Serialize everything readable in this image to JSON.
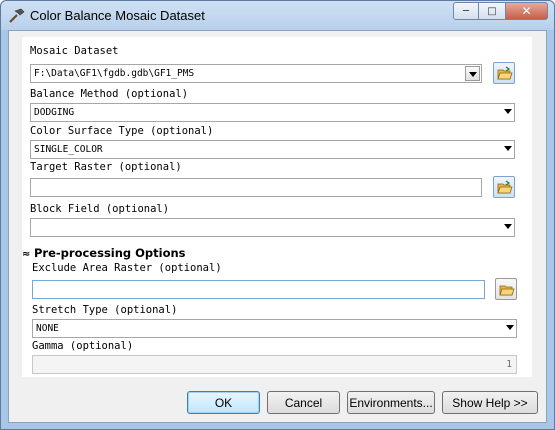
{
  "window": {
    "title": "Color Balance Mosaic Dataset",
    "controls": {
      "minimize": "─",
      "maximize": "□",
      "close": "✕"
    }
  },
  "params": {
    "mosaic_dataset": {
      "label": "Mosaic Dataset",
      "value": "F:\\Data\\GF1\\fgdb.gdb\\GF1_PMS"
    },
    "balance_method": {
      "label": "Balance Method (optional)",
      "value": "DODGING"
    },
    "color_surface_type": {
      "label": "Color Surface Type (optional)",
      "value": "SINGLE_COLOR"
    },
    "target_raster": {
      "label": "Target Raster (optional)",
      "value": ""
    },
    "block_field": {
      "label": "Block Field (optional)",
      "value": ""
    }
  },
  "preprocessing": {
    "header": "Pre-processing Options",
    "chevron": "≈",
    "exclude_area_raster": {
      "label": "Exclude Area Raster (optional)",
      "value": ""
    },
    "stretch_type": {
      "label": "Stretch Type (optional)",
      "value": "NONE"
    },
    "gamma": {
      "label": "Gamma (optional)",
      "value": "1"
    }
  },
  "buttons": {
    "ok": "OK",
    "cancel": "Cancel",
    "environments": "Environments...",
    "show_help": "Show Help >>"
  },
  "icons": {
    "title": "hammer-icon",
    "browse": "folder-open-icon"
  }
}
